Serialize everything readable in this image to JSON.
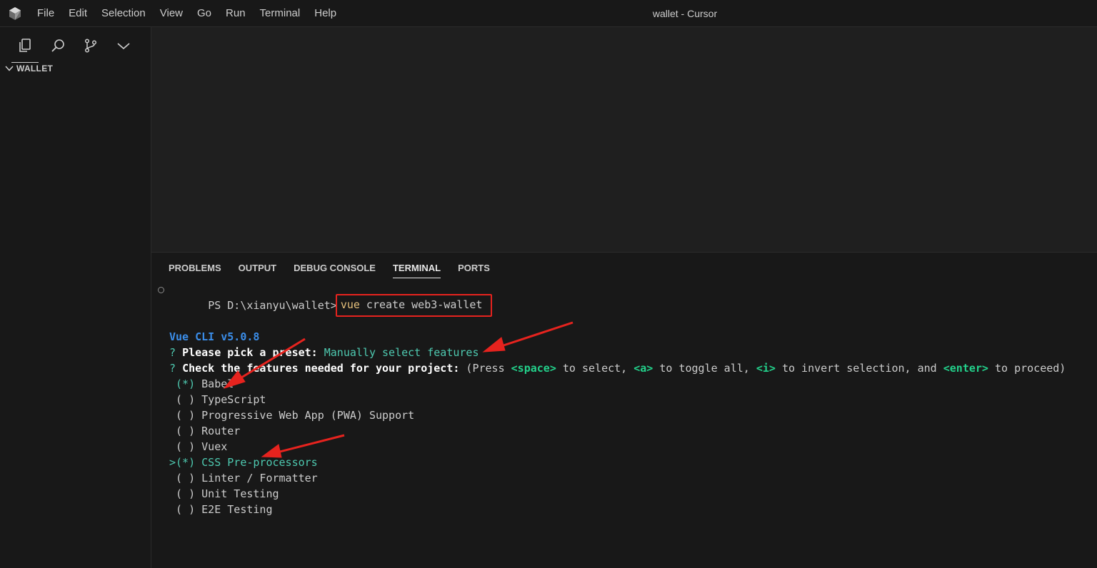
{
  "titlebar": {
    "menu": [
      "File",
      "Edit",
      "Selection",
      "View",
      "Go",
      "Run",
      "Terminal",
      "Help"
    ],
    "title": "wallet - Cursor"
  },
  "sidebar": {
    "activity_icons": [
      "files-icon",
      "search-icon",
      "source-control-icon",
      "chevron-down-icon"
    ],
    "explorer_title": "WALLET"
  },
  "panel": {
    "tabs": [
      "PROBLEMS",
      "OUTPUT",
      "DEBUG CONSOLE",
      "TERMINAL",
      "PORTS"
    ],
    "active_tab": "TERMINAL"
  },
  "terminal": {
    "prompt": "PS D:\\xianyu\\wallet>",
    "cmd_word": "vue",
    "cmd_rest": " create web3-wallet",
    "version": "Vue CLI v5.0.8",
    "q1_mark": "?",
    "q1_label": "Please pick a preset:",
    "q1_answer": "Manually select features",
    "q2_mark": "?",
    "q2_label": "Check the features needed for your project:",
    "q2_hint_1": " (Press ",
    "q2_key_space": "<space>",
    "q2_hint_2": " to select, ",
    "q2_key_a": "<a>",
    "q2_hint_3": " to toggle all, ",
    "q2_key_i": "<i>",
    "q2_hint_4": " to invert selection, and ",
    "q2_key_enter": "<enter>",
    "q2_hint_5": " to proceed)",
    "features": [
      {
        "marker": " (*)",
        "label": "Babel",
        "selected": true,
        "cursor": false
      },
      {
        "marker": " ( )",
        "label": "TypeScript",
        "selected": false,
        "cursor": false
      },
      {
        "marker": " ( )",
        "label": "Progressive Web App (PWA) Support",
        "selected": false,
        "cursor": false
      },
      {
        "marker": " ( )",
        "label": "Router",
        "selected": false,
        "cursor": false
      },
      {
        "marker": " ( )",
        "label": "Vuex",
        "selected": false,
        "cursor": false
      },
      {
        "marker": ">(*)",
        "label": "CSS Pre-processors",
        "selected": true,
        "cursor": true
      },
      {
        "marker": " ( )",
        "label": "Linter / Formatter",
        "selected": false,
        "cursor": false
      },
      {
        "marker": " ( )",
        "label": "Unit Testing",
        "selected": false,
        "cursor": false
      },
      {
        "marker": " ( )",
        "label": "E2E Testing",
        "selected": false,
        "cursor": false
      }
    ]
  },
  "colors": {
    "annotation": "#e6231e",
    "selected": "#4ec9b0",
    "version": "#3b8eea"
  }
}
